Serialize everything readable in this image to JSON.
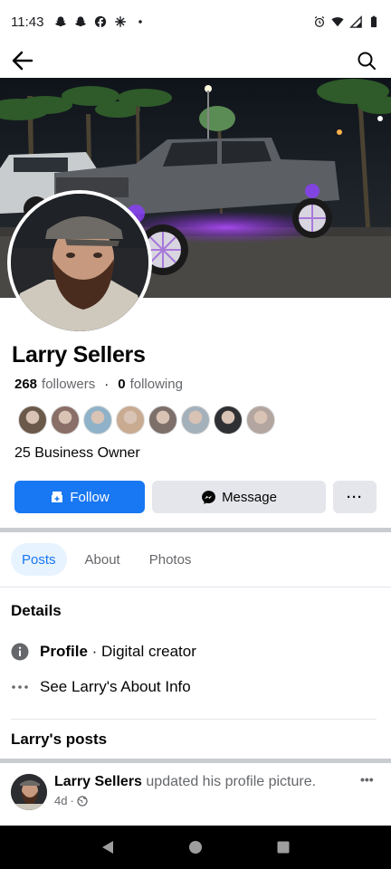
{
  "status_bar": {
    "time": "11:43",
    "left_icons": [
      "snapchat-icon",
      "snapchat-icon",
      "facebook-icon",
      "pinwheel-icon",
      "dot-icon"
    ],
    "right_icons": [
      "alarm-icon",
      "wifi-icon",
      "signal-icon",
      "battery-icon"
    ]
  },
  "nav": {
    "back_icon": "arrow-left-icon",
    "search_icon": "search-icon"
  },
  "profile": {
    "name": "Larry Sellers",
    "followers_count": "268",
    "followers_label": "followers",
    "following_count": "0",
    "following_label": "following",
    "separator": "·",
    "bio": "25 Business Owner"
  },
  "follower_avatars": [
    {
      "color": "#6b5a4a"
    },
    {
      "color": "#8a6e68"
    },
    {
      "color": "#8fb2c9"
    },
    {
      "color": "#c9ab92"
    },
    {
      "color": "#7d6f6a"
    },
    {
      "color": "#a5b1ba"
    },
    {
      "color": "#2f3034"
    },
    {
      "color": "#b3a59f"
    }
  ],
  "actions": {
    "follow_label": "Follow",
    "message_label": "Message",
    "more_label": "···"
  },
  "tabs": [
    {
      "label": "Posts",
      "active": true
    },
    {
      "label": "About",
      "active": false
    },
    {
      "label": "Photos",
      "active": false
    }
  ],
  "details": {
    "title": "Details",
    "profile_label": "Profile",
    "profile_value": " · Digital creator",
    "about_link": "See Larry's About Info"
  },
  "posts": {
    "title": "Larry's posts",
    "author": "Larry Sellers",
    "action": " updated his profile picture.",
    "time": "4d",
    "meta_separator": "·",
    "more_label": "•••"
  },
  "colors": {
    "accent": "#1877f2",
    "button_gray": "#e4e6eb",
    "tab_active_bg": "#e7f3ff",
    "separator": "#c9ccd1"
  }
}
